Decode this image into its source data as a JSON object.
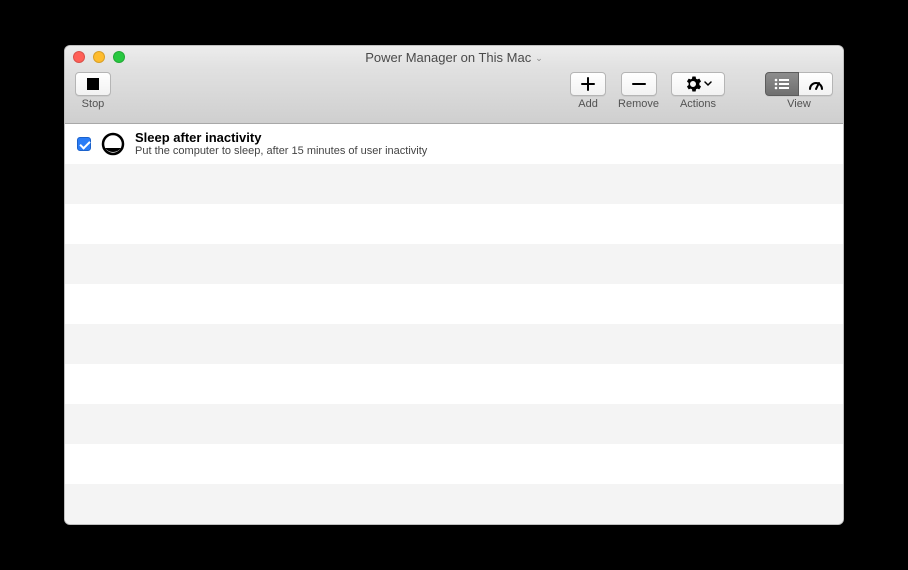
{
  "window": {
    "title": "Power Manager on This Mac"
  },
  "toolbar": {
    "stop_label": "Stop",
    "add_label": "Add",
    "remove_label": "Remove",
    "actions_label": "Actions",
    "view_label": "View"
  },
  "list": {
    "items": [
      {
        "enabled": true,
        "title": "Sleep after inactivity",
        "description": "Put the computer to sleep, after 15 minutes of user inactivity"
      }
    ]
  }
}
